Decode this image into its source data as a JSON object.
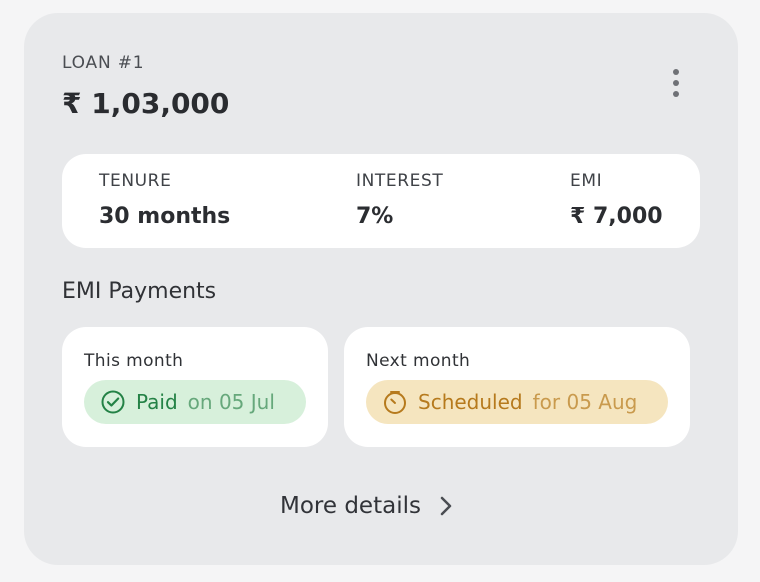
{
  "loan": {
    "label": "LOAN #1",
    "amount": "₹ 1,03,000"
  },
  "summary": {
    "tenure_label": "TENURE",
    "tenure_value": "30 months",
    "interest_label": "INTEREST",
    "interest_value": "7%",
    "emi_label": "EMI",
    "emi_value": "₹ 7,000"
  },
  "emi_payments": {
    "title": "EMI Payments",
    "this_month": {
      "title": "This month",
      "status": "Paid",
      "detail": "on 05 Jul",
      "icon": "check-circle-icon"
    },
    "next_month": {
      "title": "Next month",
      "status": "Scheduled",
      "detail": "for 05 Aug",
      "icon": "timer-icon"
    }
  },
  "footer": {
    "more_details_label": "More details",
    "icon": "chevron-right-icon"
  },
  "colors": {
    "card_bg": "#e8e9eb",
    "paid_green": "#248246",
    "scheduled_orange": "#b67a1d"
  },
  "icons": {
    "menu": "vertical-ellipsis-icon"
  }
}
